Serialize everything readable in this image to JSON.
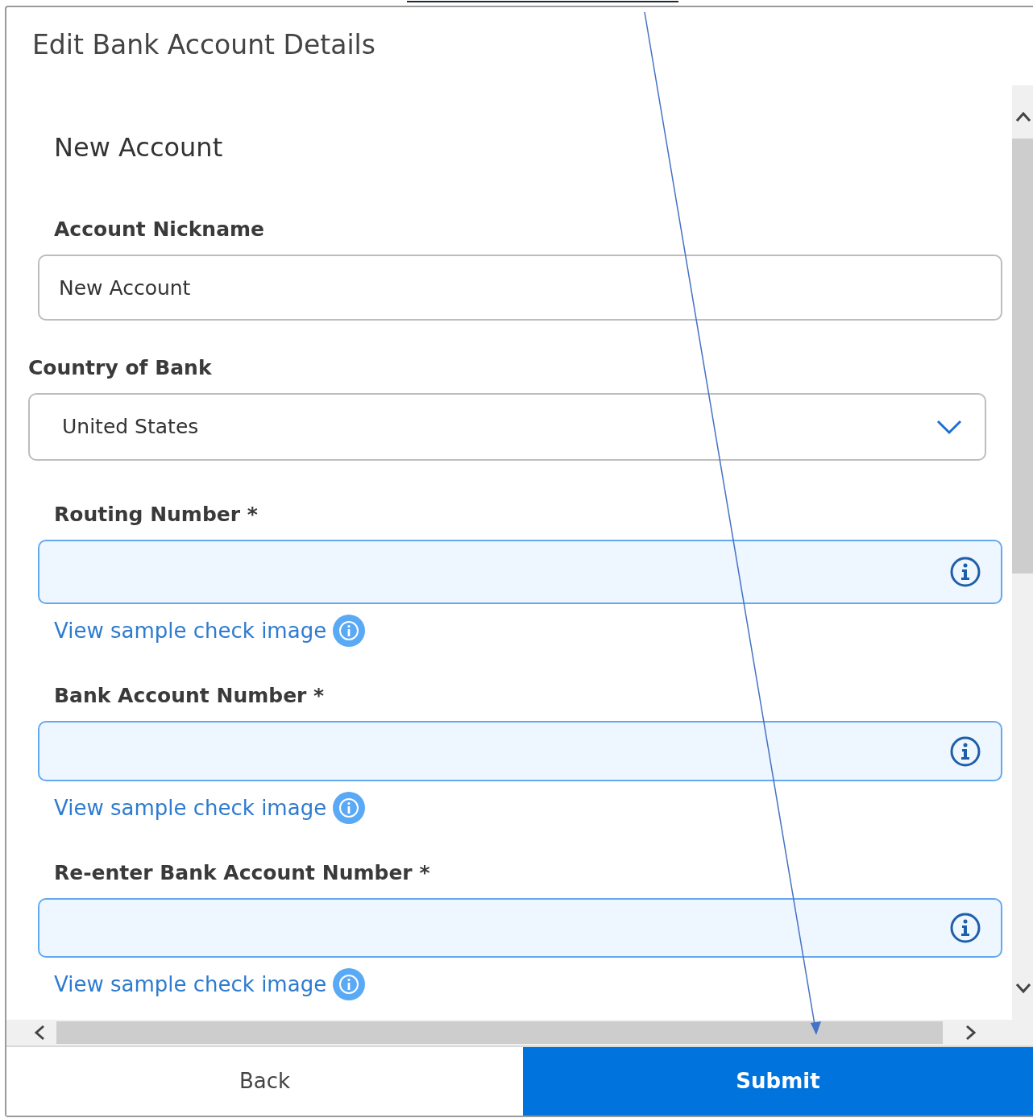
{
  "dialog": {
    "title": "Edit Bank Account Details"
  },
  "form": {
    "heading": "New Account",
    "fields": [
      {
        "kind": "text",
        "label": "Account Nickname",
        "value": "New Account"
      },
      {
        "kind": "select",
        "label": "Country of Bank",
        "value": "United States"
      },
      {
        "kind": "info",
        "label": "Routing Number *",
        "link": "View sample check image"
      },
      {
        "kind": "info",
        "label": "Bank Account Number *",
        "link": "View sample check image"
      },
      {
        "kind": "info",
        "label": "Re-enter Bank Account Number *",
        "link": "View sample check image"
      }
    ]
  },
  "buttons": [
    {
      "kind": "secondary",
      "label": "Back"
    },
    {
      "kind": "primary",
      "label": "Submit"
    }
  ]
}
